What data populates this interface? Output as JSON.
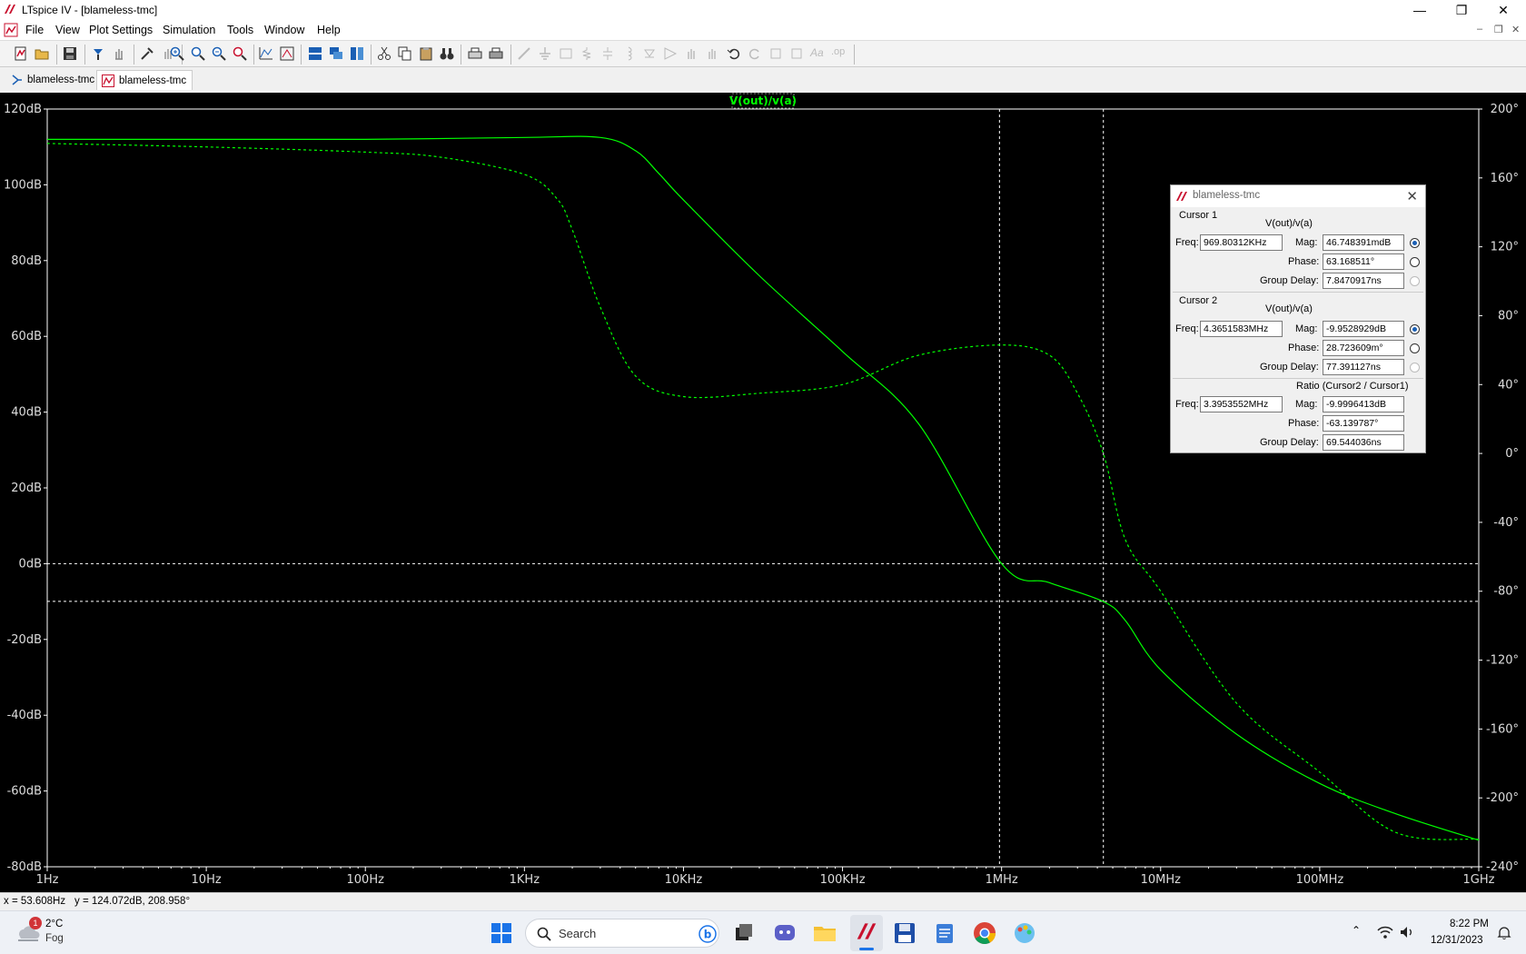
{
  "window": {
    "title": "LTspice IV - [blameless-tmc]"
  },
  "menu": {
    "items": [
      "File",
      "View",
      "Plot Settings",
      "Simulation",
      "Tools",
      "Window",
      "Help"
    ]
  },
  "tabs": [
    {
      "label": "blameless-tmc",
      "kind": "schematic"
    },
    {
      "label": "blameless-tmc",
      "kind": "waveform"
    }
  ],
  "plot": {
    "trace_label": "V(out)/v(a)",
    "trace_color": "#00ff00",
    "left_ticks": [
      "120dB",
      "100dB",
      "80dB",
      "60dB",
      "40dB",
      "20dB",
      "0dB",
      "-20dB",
      "-40dB",
      "-60dB",
      "-80dB"
    ],
    "right_ticks": [
      "200°",
      "160°",
      "120°",
      "80°",
      "40°",
      "0°",
      "-40°",
      "-80°",
      "-120°",
      "-160°",
      "-200°",
      "-240°"
    ],
    "x_ticks": [
      "1Hz",
      "10Hz",
      "100Hz",
      "1KHz",
      "10KHz",
      "100KHz",
      "1MHz",
      "10MHz",
      "100MHz",
      "1GHz"
    ]
  },
  "chart_data": {
    "type": "line",
    "xscale": "log",
    "xlim_hz": [
      1,
      1000000000
    ],
    "ylim_db": [
      -80,
      120
    ],
    "y2lim_deg": [
      -240,
      200
    ],
    "grid": false,
    "series": [
      {
        "name": "V(out)/v(a)",
        "kind": "magnitude_db",
        "style": "solid",
        "x": [
          1,
          10,
          100,
          1000,
          3000,
          5000,
          7000,
          10000,
          30000,
          100000,
          300000,
          1000000,
          2000000,
          4365158,
          6000000,
          10000000,
          30000000,
          100000000,
          300000000,
          1000000000
        ],
        "y": [
          112,
          112,
          112,
          112.5,
          112.5,
          109,
          103,
          96,
          76,
          56,
          37,
          0,
          -5,
          -10,
          -15,
          -28,
          -45,
          -58,
          -66,
          -73
        ]
      },
      {
        "name": "V(out)/v(a)",
        "kind": "phase_deg",
        "style": "dashed",
        "x": [
          1,
          10,
          100,
          300,
          1000,
          1600,
          2000,
          3000,
          5000,
          10000,
          30000,
          100000,
          300000,
          1000000,
          2000000,
          3000000,
          4365158,
          6000000,
          10000000,
          30000000,
          100000000,
          300000000,
          1000000000
        ],
        "y": [
          180,
          178,
          175,
          172,
          162,
          148,
          130,
          85,
          45,
          33,
          35,
          40,
          57,
          63,
          57,
          35,
          0,
          -50,
          -80,
          -145,
          -185,
          -220,
          -224
        ]
      }
    ],
    "cursors": [
      {
        "x_hz": 969803.12,
        "y_db": 0
      },
      {
        "x_hz": 4365158.3,
        "y_db": -9.95
      }
    ]
  },
  "cursor_panel": {
    "title": "blameless-tmc",
    "cursor1": {
      "label": "Cursor 1",
      "expr": "V(out)/v(a)",
      "freq_label": "Freq:",
      "freq": "969.80312KHz",
      "mag_label": "Mag:",
      "mag": "46.748391mdB",
      "phase_label": "Phase:",
      "phase": "63.168511°",
      "gd_label": "Group Delay:",
      "gd": "7.8470917ns"
    },
    "cursor2": {
      "label": "Cursor 2",
      "expr": "V(out)/v(a)",
      "freq_label": "Freq:",
      "freq": "4.3651583MHz",
      "mag_label": "Mag:",
      "mag": "-9.9528929dB",
      "phase_label": "Phase:",
      "phase": "28.723609m°",
      "gd_label": "Group Delay:",
      "gd": "77.391127ns"
    },
    "ratio": {
      "label": "Ratio (Cursor2 / Cursor1)",
      "freq_label": "Freq:",
      "freq": "3.3953552MHz",
      "mag_label": "Mag:",
      "mag": "-9.9996413dB",
      "phase_label": "Phase:",
      "phase": "-63.139787°",
      "gd_label": "Group Delay:",
      "gd": "69.544036ns"
    }
  },
  "status": {
    "x": "x = 53.608Hz",
    "y": "y = 124.072dB, 208.958°"
  },
  "taskbar": {
    "weather_temp": "2°C",
    "weather_desc": "Fog",
    "weather_badge": "1",
    "search_placeholder": "Search",
    "time": "8:22 PM",
    "date": "12/31/2023"
  }
}
